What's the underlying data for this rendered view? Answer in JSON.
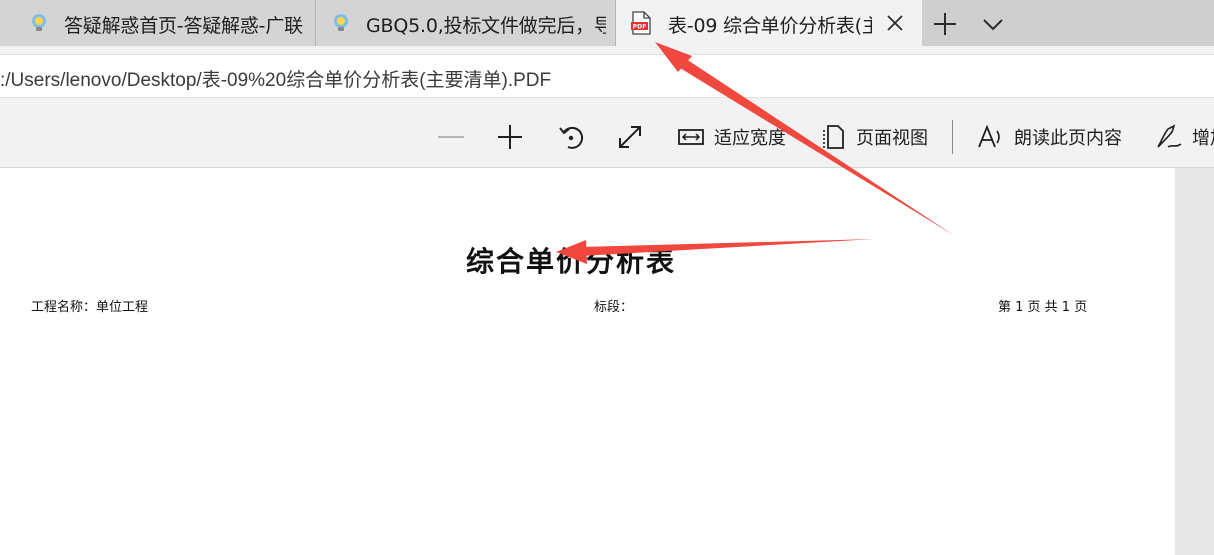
{
  "tabs": [
    {
      "title": "答疑解惑首页-答疑解惑-广联",
      "icon": "lightbulb-icon",
      "active": false
    },
    {
      "title": "GBQ5.0,投标文件做完后，导",
      "icon": "lightbulb-icon",
      "active": false
    },
    {
      "title": "表-09 综合单价分析表(主",
      "icon": "pdf-icon",
      "active": true
    }
  ],
  "address": {
    "url": ":/Users/lenovo/Desktop/表-09%20综合单价分析表(主要清单).PDF"
  },
  "toolbar": {
    "zoom_out": "zoom-out-icon",
    "zoom_in": "zoom-in-icon",
    "rotate": "rotate-icon",
    "fullscreen": "fullscreen-icon",
    "fit_width_label": "适应宽度",
    "page_view_label": "页面视图",
    "read_aloud_label": "朗读此页内容",
    "add_notes_label": "增加"
  },
  "document": {
    "title": "综合单价分析表",
    "project_label": "工程名称：单位工程",
    "section_label": "标段：",
    "page_info": "第 1 页   共 1 页"
  },
  "colors": {
    "annotation_arrow": "#f0473f",
    "pdf_icon_red": "#e2312e",
    "tab_strip": "#cfcfcf",
    "active_tab": "#f2f2f2",
    "toolbar_bg": "#f2f2f2"
  }
}
